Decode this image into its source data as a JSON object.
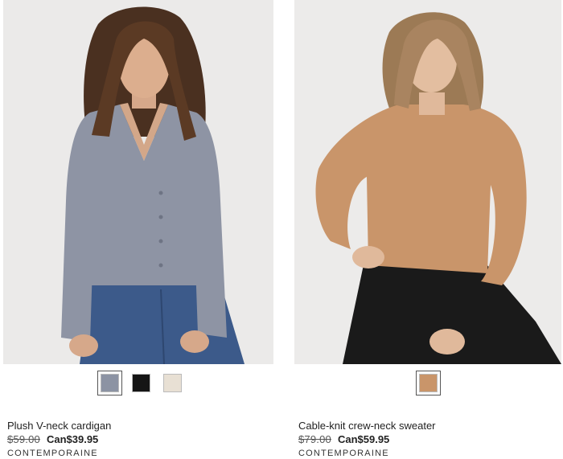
{
  "products": [
    {
      "name": "Plush V-neck cardigan",
      "original_price": "$59.00",
      "sale_price": "Can$39.95",
      "brand": "CONTEMPORAINE",
      "image_description_icon": "model-grey-cardigan-image",
      "swatches": [
        {
          "color": "#8c93a3",
          "selected": true
        },
        {
          "color": "#151515",
          "selected": false
        },
        {
          "color": "#e8e0d4",
          "selected": false
        }
      ]
    },
    {
      "name": "Cable-knit crew-neck sweater",
      "original_price": "$79.00",
      "sale_price": "Can$59.95",
      "brand": "CONTEMPORAINE",
      "image_description_icon": "model-tan-sweater-image",
      "swatches": [
        {
          "color": "#c9956a",
          "selected": true
        }
      ]
    }
  ]
}
